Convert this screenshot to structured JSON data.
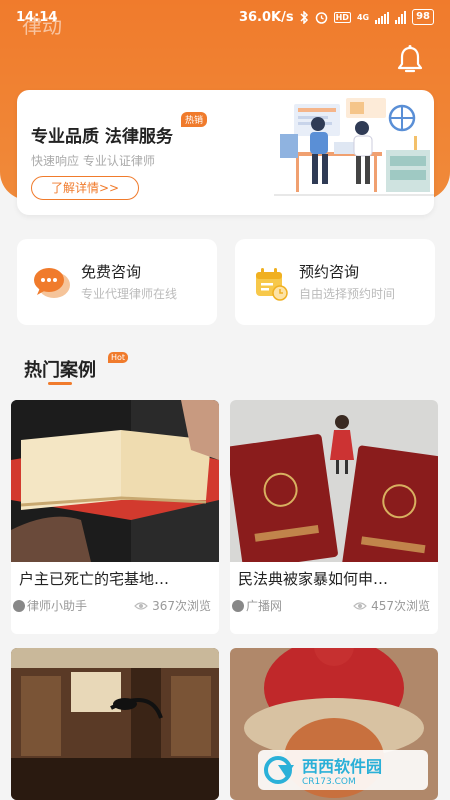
{
  "status": {
    "time": "14:14",
    "speed": "36.0K/s",
    "hd": "HD",
    "network": "4G",
    "battery": "98"
  },
  "app": {
    "title": "律动"
  },
  "banner": {
    "title": "专业品质 法律服务",
    "badge": "热销",
    "subtitle": "快速响应 专业认证律师",
    "button": "了解详情>>"
  },
  "services": [
    {
      "title": "免费咨询",
      "subtitle": "专业代理律师在线"
    },
    {
      "title": "预约咨询",
      "subtitle": "自由选择预约时间"
    }
  ],
  "section": {
    "title": "热门案例",
    "badge": "Hot"
  },
  "cases": [
    {
      "title": "户主已死亡的宅基地…",
      "author": "律师小助手",
      "views": "367次浏览"
    },
    {
      "title": "民法典被家暴如何申…",
      "author": "广播网",
      "views": "457次浏览"
    }
  ],
  "watermark": {
    "text": "西西软件园",
    "url": "CR173.COM"
  },
  "colors": {
    "accent": "#f07b2c"
  }
}
